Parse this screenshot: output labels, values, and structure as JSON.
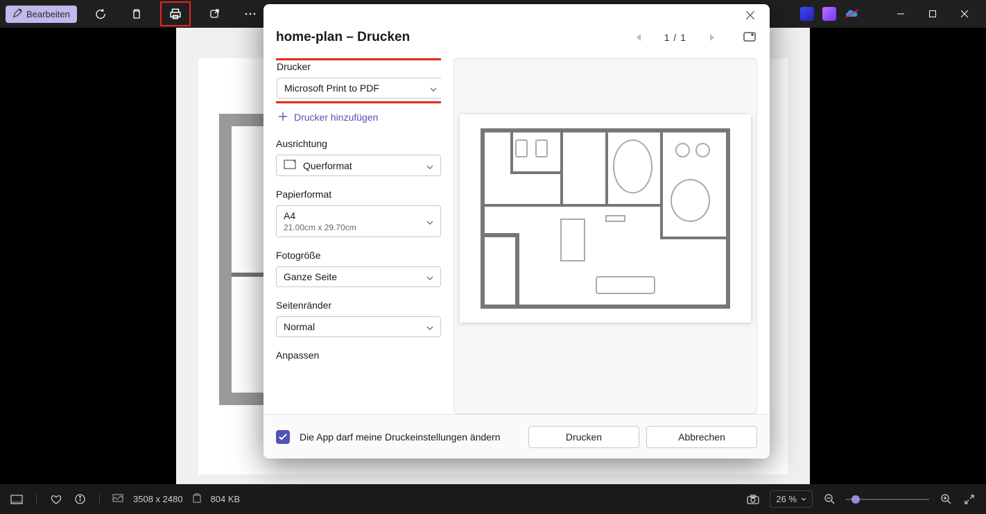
{
  "toolbar": {
    "edit_label": "Bearbeiten"
  },
  "modal": {
    "title": "home-plan – Drucken",
    "page_indicator": "1 / 1",
    "labels": {
      "printer": "Drucker",
      "orientation": "Ausrichtung",
      "paper_format": "Papierformat",
      "photo_size": "Fotogröße",
      "page_margins": "Seitenränder",
      "fit": "Anpassen"
    },
    "printer": {
      "selected": "Microsoft Print to PDF"
    },
    "add_printer_label": "Drucker hinzufügen",
    "orientation": {
      "selected": "Querformat"
    },
    "paper_format": {
      "selected": "A4",
      "dimensions": "21.00cm x 29.70cm"
    },
    "photo_size": {
      "selected": "Ganze Seite"
    },
    "page_margins": {
      "selected": "Normal"
    },
    "footer": {
      "allow_change_text": "Die App darf meine Druckeinstellungen ändern",
      "print_label": "Drucken",
      "cancel_label": "Abbrechen"
    }
  },
  "status": {
    "resolution": "3508 x 2480",
    "file_size": "804 KB",
    "zoom": "26 %"
  }
}
